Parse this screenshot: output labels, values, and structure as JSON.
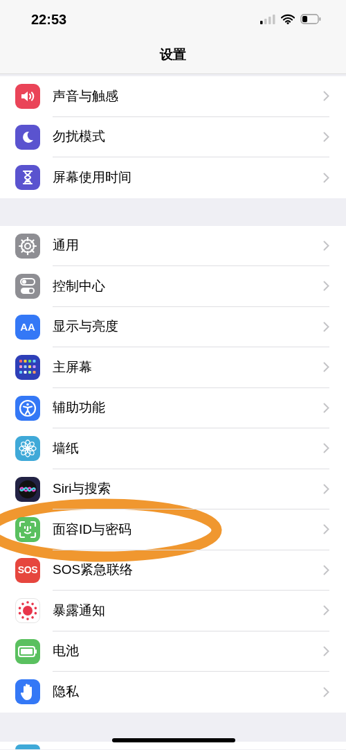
{
  "status_bar": {
    "time": "22:53"
  },
  "nav": {
    "title": "设置"
  },
  "groups": [
    {
      "items": [
        {
          "label": "声音与触感",
          "kind": "sound",
          "color": "#ea4458"
        },
        {
          "label": "勿扰模式",
          "kind": "moon",
          "color": "#5a53cf"
        },
        {
          "label": "屏幕使用时间",
          "kind": "hourglass",
          "color": "#5a53cf"
        }
      ]
    },
    {
      "items": [
        {
          "label": "通用",
          "kind": "gear",
          "color": "#8e8e93"
        },
        {
          "label": "控制中心",
          "kind": "toggles",
          "color": "#8e8e93"
        },
        {
          "label": "显示与亮度",
          "kind": "text",
          "icon_text": "AA",
          "color": "#3478f6"
        },
        {
          "label": "主屏幕",
          "kind": "grid",
          "color": "#2e3fb8"
        },
        {
          "label": "辅助功能",
          "kind": "accessibility",
          "color": "#3478f6"
        },
        {
          "label": "墙纸",
          "kind": "flower",
          "color": "#3fa9d8"
        },
        {
          "label": "Siri与搜索",
          "kind": "siri",
          "color": "#222244"
        },
        {
          "label": "面容ID与密码",
          "kind": "face",
          "color": "#5ac05f"
        },
        {
          "label": "SOS紧急联络",
          "kind": "text",
          "icon_text": "SOS",
          "color": "#e6463e"
        },
        {
          "label": "暴露通知",
          "kind": "virus",
          "color": "#ffffff"
        },
        {
          "label": "电池",
          "kind": "battery",
          "color": "#5ac05f"
        },
        {
          "label": "隐私",
          "kind": "hand",
          "color": "#3478f6"
        }
      ]
    }
  ]
}
